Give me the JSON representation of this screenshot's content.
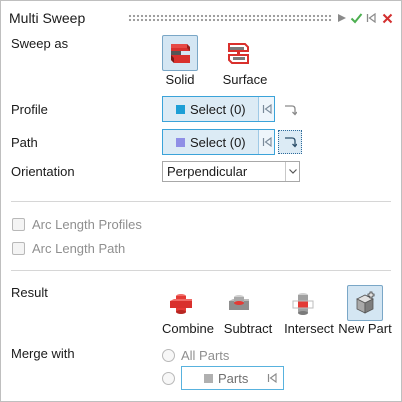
{
  "header": {
    "title": "Multi Sweep",
    "buttons": [
      {
        "name": "play-icon",
        "color": "#8a8a8a"
      },
      {
        "name": "checkmark-icon",
        "color": "#4caf50"
      },
      {
        "name": "exit-icon",
        "color": "#8a8a8a"
      },
      {
        "name": "close-icon",
        "color": "#d32f2f"
      }
    ]
  },
  "sweep_as": {
    "label": "Sweep as",
    "options": [
      {
        "label": "Solid",
        "icon": "solid-sweep-icon",
        "selected": true
      },
      {
        "label": "Surface",
        "icon": "surface-sweep-icon",
        "selected": false
      }
    ]
  },
  "profile": {
    "label": "Profile",
    "select_text": "Select (0)",
    "swatch_color": "#1e9fd6",
    "reset_icon": "reset-icon",
    "reverse_icon": "reverse-direction-icon"
  },
  "path": {
    "label": "Path",
    "select_text": "Select (0)",
    "swatch_color": "#8f8fe6",
    "reset_icon": "reset-icon",
    "reverse_icon": "reverse-direction-icon"
  },
  "orientation": {
    "label": "Orientation",
    "value": "Perpendicular"
  },
  "options": {
    "arc_length_profiles": {
      "label": "Arc Length Profiles",
      "checked": false,
      "enabled": false
    },
    "arc_length_path": {
      "label": "Arc Length Path",
      "checked": false,
      "enabled": false
    }
  },
  "result": {
    "label": "Result",
    "options": [
      {
        "label": "Combine",
        "icon": "combine-icon",
        "selected": false
      },
      {
        "label": "Subtract",
        "icon": "subtract-icon",
        "selected": false
      },
      {
        "label": "Intersect",
        "icon": "intersect-icon",
        "selected": false
      },
      {
        "label": "New Part",
        "icon": "new-part-icon",
        "selected": true
      }
    ]
  },
  "merge_with": {
    "label": "Merge with",
    "all_parts_label": "All Parts",
    "parts_label": "Parts",
    "all_parts_selected": false,
    "parts_selected": false
  }
}
